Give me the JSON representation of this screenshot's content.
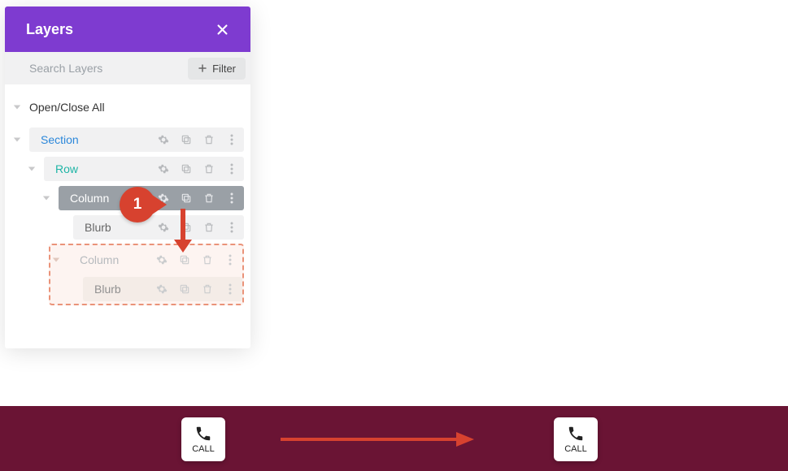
{
  "panel": {
    "title": "Layers",
    "search_placeholder": "Search Layers",
    "filter_label": "Filter"
  },
  "tree": {
    "open_close": "Open/Close All",
    "section": "Section",
    "row": "Row",
    "column1": "Column",
    "blurb1": "Blurb",
    "column2": "Column",
    "blurb2": "Blurb"
  },
  "badge": {
    "number": "1"
  },
  "footer": {
    "call1": "CALL",
    "call2": "CALL"
  }
}
